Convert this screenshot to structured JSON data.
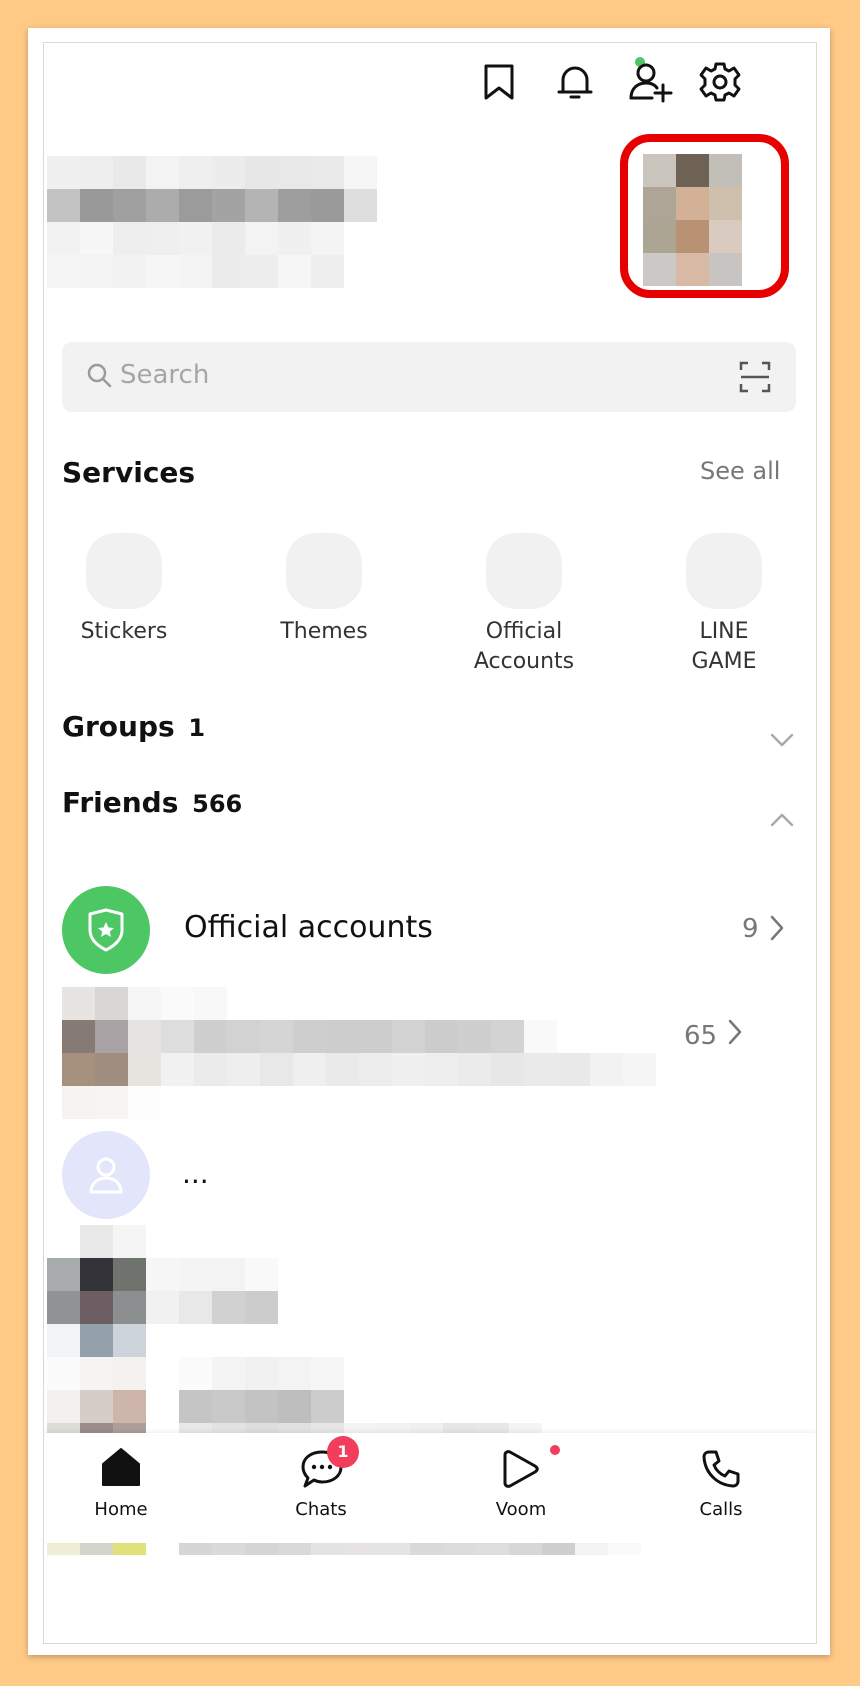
{
  "header": {
    "icons": [
      "bookmark-icon",
      "bell-icon",
      "add-friend-icon",
      "gear-icon"
    ],
    "notification_dot_color": "#4cc764"
  },
  "highlight_color": "#e60000",
  "search": {
    "placeholder": "Search"
  },
  "services": {
    "title": "Services",
    "see_all": "See all",
    "items": [
      {
        "label": "Stickers"
      },
      {
        "label": "Themes"
      },
      {
        "label": "Official\nAccounts"
      },
      {
        "label": "LINE\nGAME"
      }
    ]
  },
  "groups": {
    "title": "Groups",
    "count": "1"
  },
  "friends": {
    "title": "Friends",
    "count": "566",
    "official": {
      "label": "Official accounts",
      "count": "9",
      "icon_color": "#4cc764"
    },
    "row2_count": "65",
    "row3_label": "..."
  },
  "bottom_nav": {
    "items": [
      {
        "label": "Home"
      },
      {
        "label": "Chats",
        "badge": "1"
      },
      {
        "label": "Voom"
      },
      {
        "label": "Calls"
      }
    ],
    "badge_color": "#f23d5c"
  }
}
